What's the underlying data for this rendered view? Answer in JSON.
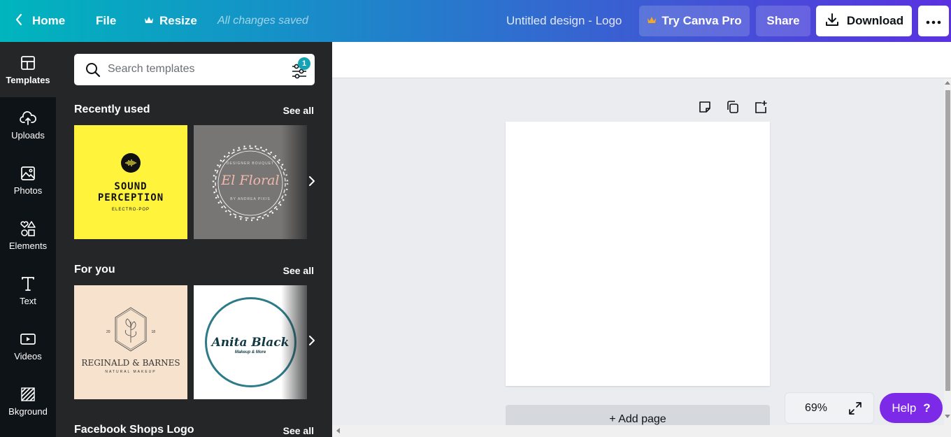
{
  "topbar": {
    "home_label": "Home",
    "file_label": "File",
    "resize_label": "Resize",
    "saved_status": "All changes saved",
    "design_title": "Untitled design - Logo",
    "try_pro_label": "Try Canva Pro",
    "share_label": "Share",
    "download_label": "Download"
  },
  "rail": {
    "items": [
      {
        "label": "Templates",
        "icon": "templates-icon",
        "active": true
      },
      {
        "label": "Uploads",
        "icon": "upload-cloud-icon"
      },
      {
        "label": "Photos",
        "icon": "image-icon"
      },
      {
        "label": "Elements",
        "icon": "shapes-icon"
      },
      {
        "label": "Text",
        "icon": "text-t-icon"
      },
      {
        "label": "Videos",
        "icon": "video-play-icon"
      },
      {
        "label": "Bkground",
        "icon": "background-hatch-icon"
      }
    ]
  },
  "panel": {
    "search_placeholder": "Search templates",
    "filter_badge": "1",
    "sections": [
      {
        "title": "Recently used",
        "see_all": "See all"
      },
      {
        "title": "For you",
        "see_all": "See all"
      },
      {
        "title": "Facebook Shops Logo",
        "see_all": "See all"
      }
    ],
    "templates": {
      "sound": {
        "line1": "SOUND",
        "line2": "PERCEPTION",
        "sub": "ELECTRO-POP"
      },
      "floral": {
        "top": "DESIGNER BOUQUET",
        "name": "El Floral",
        "by": "BY ANDREA PIXIS"
      },
      "reginald": {
        "year_left": "20",
        "year_right": "18",
        "name": "REGINALD & BARNES",
        "sub": "NATURAL MAKEUP"
      },
      "anita": {
        "name": "Anita Black",
        "sub": "Makeup & More"
      }
    }
  },
  "canvas": {
    "add_page_label": "+ Add page",
    "zoom_value": "69%",
    "help_label": "Help",
    "help_mark": "?"
  },
  "colors": {
    "help": "#7d2ae8",
    "rail": "#0e1318",
    "panel": "#252627",
    "badge": "#13a3b5",
    "crown": "#f5a623"
  }
}
